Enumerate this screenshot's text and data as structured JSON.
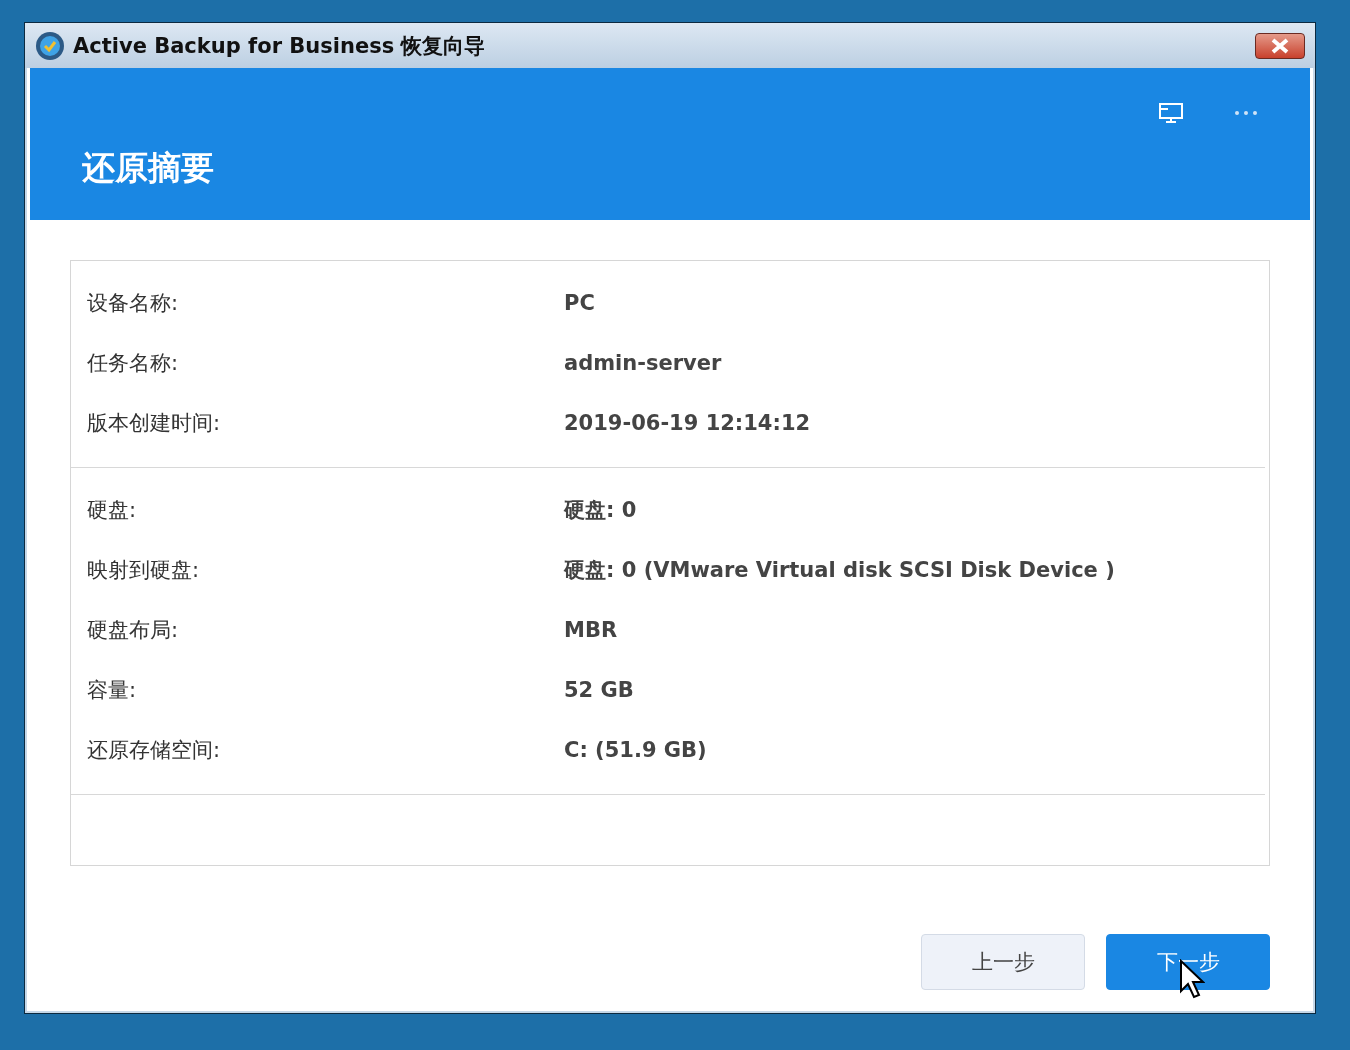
{
  "window": {
    "title": "Active Backup for Business 恢复向导"
  },
  "header": {
    "title": "还原摘要"
  },
  "sections": [
    {
      "rows": [
        {
          "label": "设备名称:",
          "value": "PC"
        },
        {
          "label": "任务名称:",
          "value": "admin-server"
        },
        {
          "label": "版本创建时间:",
          "value": "2019-06-19 12:14:12"
        }
      ]
    },
    {
      "rows": [
        {
          "label": "硬盘:",
          "value": "**硬盘:** 0"
        },
        {
          "label": "映射到硬盘:",
          "value": "**硬盘:** 0 (VMware Virtual disk SCSI Disk Device )"
        },
        {
          "label": "硬盘布局:",
          "value": "MBR"
        },
        {
          "label": "容量:",
          "value": "52 GB"
        },
        {
          "label": "还原存储空间:",
          "value": "C: (51.9 GB)"
        }
      ]
    }
  ],
  "buttons": [
    {
      "label": "上一步",
      "kind": "secondary"
    },
    {
      "label": "下一步",
      "kind": "primary"
    }
  ]
}
